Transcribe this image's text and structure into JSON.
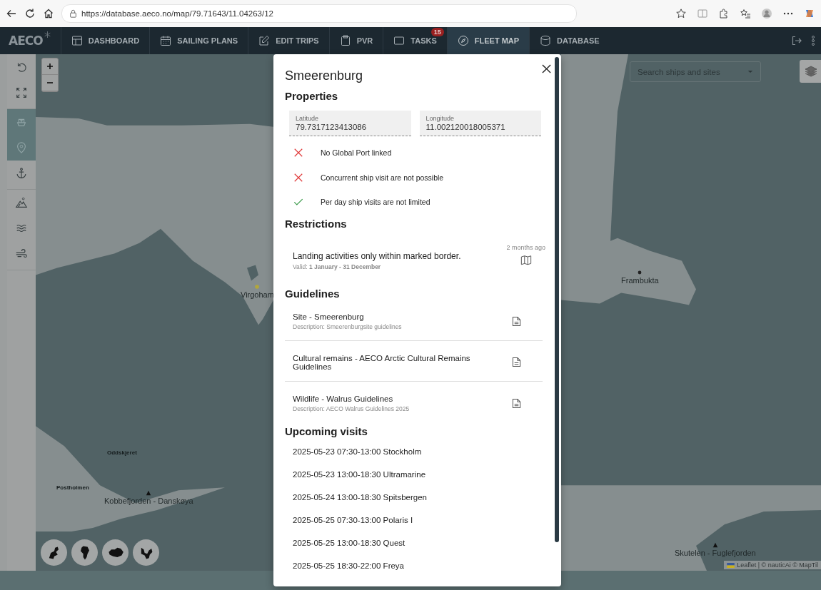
{
  "browser": {
    "url": "https://database.aeco.no/map/79.71643/11.04263/12"
  },
  "nav": {
    "logo": "AECO",
    "tabs": [
      {
        "label": "DASHBOARD",
        "selected": false
      },
      {
        "label": "SAILING PLANS",
        "selected": false
      },
      {
        "label": "EDIT TRIPS",
        "selected": false
      },
      {
        "label": "PVR",
        "selected": false
      },
      {
        "label": "TASKS",
        "badge": "15",
        "selected": false
      },
      {
        "label": "FLEET MAP",
        "selected": true
      },
      {
        "label": "DATABASE",
        "selected": false
      }
    ]
  },
  "toolbar": [
    {
      "kind": "undo",
      "selected": false
    },
    {
      "kind": "expand",
      "selected": false
    },
    {
      "kind": "ship",
      "selected": true
    },
    {
      "kind": "pin",
      "selected": true
    },
    {
      "kind": "anchor",
      "selected": false
    },
    {
      "kind": "mountains",
      "selected": false
    },
    {
      "kind": "waves",
      "selected": false
    },
    {
      "kind": "wind",
      "selected": false
    }
  ],
  "map": {
    "search": {
      "placeholder": "Search ships and sites"
    },
    "labels": [
      {
        "text": "Frambukta",
        "kind": "place"
      },
      {
        "text": "Virgoham",
        "kind": "site"
      },
      {
        "text": "Oddskjeret",
        "kind": "small"
      },
      {
        "text": "Postholmen",
        "kind": "small"
      },
      {
        "text": "Kobbefjorden - Danskøya",
        "kind": "landing"
      },
      {
        "text": "Skutelen - Fuglefjorden",
        "kind": "landing"
      }
    ],
    "attribution": "Leaflet | © nauticAi © MapTil"
  },
  "dialog": {
    "title": "Smeerenburg",
    "properties": {
      "heading": "Properties",
      "fields": [
        {
          "label": "Latitude",
          "value": "79.7317123413086"
        },
        {
          "label": "Longitude",
          "value": "11.002120018005371"
        }
      ],
      "flags": [
        {
          "text": "No Global Port linked",
          "ok": false
        },
        {
          "text": "Concurrent ship visit are not possible",
          "ok": false
        },
        {
          "text": "Per day ship visits are not limited",
          "ok": true
        }
      ]
    },
    "restrictions": {
      "heading": "Restrictions",
      "items": [
        {
          "text": "Landing activities only within marked border.",
          "valid": "Valid: **1 January - 31 December**",
          "time": "2 months ago"
        }
      ]
    },
    "guidelines": {
      "heading": "Guidelines",
      "items": [
        {
          "title": "Site - Smeerenburg",
          "description": "Description: Smeerenburgsite guidelines"
        },
        {
          "title": "Cultural remains - AECO Arctic Cultural Remains Guidelines"
        },
        {
          "title": "Wildlife - Walrus Guidelines",
          "description": "Description: AECO Walrus Guidelines 2025"
        }
      ]
    },
    "visits": {
      "heading": "Upcoming visits",
      "items": [
        "2025-05-23 07:30-13:00 Stockholm",
        "2025-05-23 13:00-18:30 Ultramarine",
        "2025-05-24 13:00-18:30 Spitsbergen",
        "2025-05-25 07:30-13:00 Polaris I",
        "2025-05-25 13:00-18:30 Quest",
        "2025-05-25 18:30-22:00 Freya"
      ]
    }
  }
}
